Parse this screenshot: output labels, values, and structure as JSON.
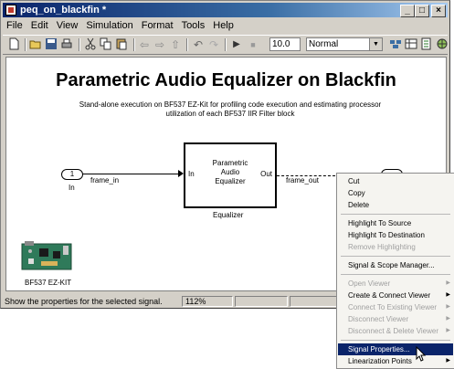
{
  "window": {
    "title": "peq_on_blackfin *"
  },
  "menubar": [
    "File",
    "Edit",
    "View",
    "Simulation",
    "Format",
    "Tools",
    "Help"
  ],
  "toolbar": {
    "stop_time": "10.0",
    "sim_mode": "Normal"
  },
  "model": {
    "title": "Parametric Audio Equalizer on Blackfin",
    "subtitle_line1": "Stand-alone execution on BF537 EZ-Kit for profiling code execution and estimating processor",
    "subtitle_line2": "utilization of each BF537 IIR Filter block",
    "inport": {
      "number": "1",
      "name": "In"
    },
    "signal_in": "frame_in",
    "block": {
      "line1": "Parametric",
      "line2": "Audio",
      "line3": "Equalizer",
      "port_in": "In",
      "port_out": "Out",
      "name": "Equalizer"
    },
    "signal_out": "frame_out",
    "board_label": "BF537 EZ-KIT"
  },
  "status": {
    "message": "Show the properties for the selected signal.",
    "zoom": "112%"
  },
  "context_menu": {
    "items": [
      {
        "label": "Cut",
        "enabled": true
      },
      {
        "label": "Copy",
        "enabled": true
      },
      {
        "label": "Delete",
        "enabled": true
      },
      {
        "label": "Highlight To Source",
        "enabled": true
      },
      {
        "label": "Highlight To Destination",
        "enabled": true
      },
      {
        "label": "Remove Highlighting",
        "enabled": false
      },
      {
        "label": "Signal & Scope Manager...",
        "enabled": true
      },
      {
        "label": "Open Viewer",
        "enabled": false
      },
      {
        "label": "Create & Connect Viewer",
        "enabled": true
      },
      {
        "label": "Connect To Existing Viewer",
        "enabled": false
      },
      {
        "label": "Disconnect Viewer",
        "enabled": false
      },
      {
        "label": "Disconnect & Delete Viewer",
        "enabled": false
      },
      {
        "label": "Signal Properties...",
        "enabled": true,
        "selected": true
      },
      {
        "label": "Linearization Points",
        "enabled": true
      }
    ]
  }
}
